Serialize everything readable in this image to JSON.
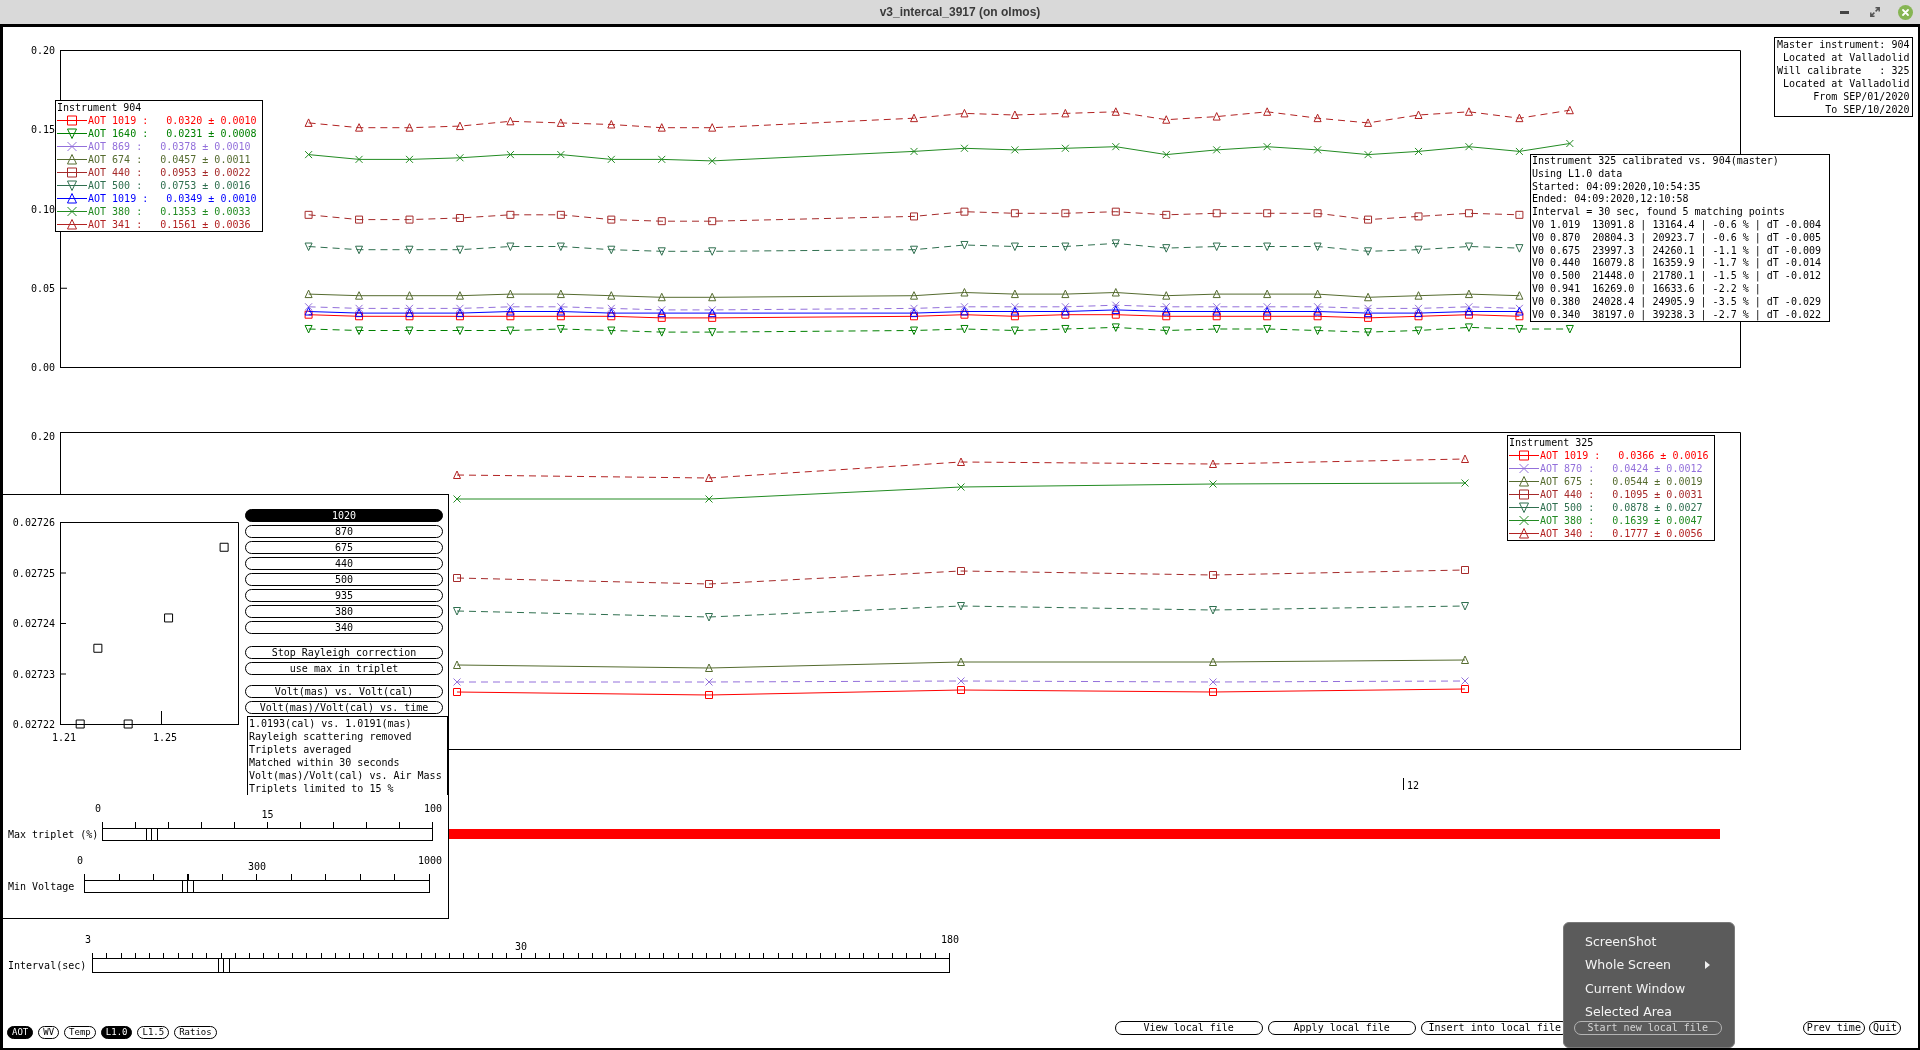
{
  "window": {
    "title": "v3_intercal_3917 (on olmos)"
  },
  "master_info": {
    "lines": [
      "Master instrument: 904",
      "Located at Valladolid",
      "Will calibrate   : 325",
      "Located at Valladolid",
      "From SEP/01/2020",
      "To SEP/10/2020"
    ]
  },
  "top_panel": {
    "legend": {
      "title": "Instrument 904",
      "items": [
        {
          "label": "AOT 1019 :",
          "value": "0.0320 ± 0.0010",
          "color": "#ff0000"
        },
        {
          "label": "AOT 1640 :",
          "value": "0.0231 ± 0.0008",
          "color": "#008000"
        },
        {
          "label": "AOT 869 :",
          "value": "0.0378 ± 0.0010",
          "color": "#9370db"
        },
        {
          "label": "AOT 674 :",
          "value": "0.0457 ± 0.0011",
          "color": "#556b2f"
        },
        {
          "label": "AOT 440 :",
          "value": "0.0953 ± 0.0022",
          "color": "#a52a2a"
        },
        {
          "label": "AOT 500 :",
          "value": "0.0753 ± 0.0016",
          "color": "#2f6f4f"
        },
        {
          "label": "AOT 1019 :",
          "value": "0.0349 ± 0.0010",
          "color": "#0000ff"
        },
        {
          "label": "AOT 380 :",
          "value": "0.1353 ± 0.0033",
          "color": "#228b22"
        },
        {
          "label": "AOT 341 :",
          "value": "0.1561 ± 0.0036",
          "color": "#b22222"
        }
      ]
    },
    "chart_data": {
      "type": "line",
      "categories": [
        null,
        null,
        null,
        null,
        null,
        null,
        null,
        null,
        null,
        null,
        null,
        null,
        null,
        null,
        null,
        null,
        null,
        null,
        null,
        null,
        null,
        null,
        null,
        null,
        null,
        null
      ],
      "ylim": [
        0,
        0.2
      ],
      "yticks": [
        {
          "value": 0,
          "label": "0.00"
        },
        {
          "value": 0.05,
          "label": "0.05"
        },
        {
          "value": 0.1,
          "label": "0.10"
        },
        {
          "value": 0.15,
          "label": "0.15"
        },
        {
          "value": 0.2,
          "label": "0.20"
        }
      ],
      "series": [
        {
          "color": "#ff0000",
          "marker": "square",
          "line_style": "solid",
          "values": [
            0.033,
            0.032,
            0.032,
            0.032,
            0.032,
            0.032,
            0.032,
            0.031,
            0.031,
            null,
            null,
            null,
            0.032,
            0.033,
            0.032,
            0.033,
            0.033,
            0.032,
            0.032,
            0.032,
            0.032,
            0.031,
            0.032,
            0.033,
            0.032,
            null
          ]
        },
        {
          "color": "#008000",
          "marker": "triangle-down",
          "line_style": "dashed",
          "values": [
            0.024,
            0.023,
            0.023,
            0.023,
            0.023,
            0.024,
            0.023,
            0.022,
            0.022,
            null,
            null,
            null,
            0.023,
            0.024,
            0.023,
            0.024,
            0.025,
            0.023,
            0.024,
            0.024,
            0.023,
            0.022,
            0.023,
            0.025,
            0.024,
            0.024
          ]
        },
        {
          "color": "#9370db",
          "marker": "cross",
          "line_style": "dashed",
          "values": [
            0.038,
            0.037,
            0.037,
            0.037,
            0.038,
            0.038,
            0.037,
            0.036,
            0.036,
            null,
            null,
            null,
            0.037,
            0.038,
            0.038,
            0.038,
            0.039,
            0.038,
            0.038,
            0.038,
            0.038,
            0.037,
            0.037,
            0.038,
            0.037,
            null
          ]
        },
        {
          "color": "#556b2f",
          "marker": "triangle-up",
          "line_style": "solid",
          "values": [
            0.046,
            0.045,
            0.045,
            0.045,
            0.046,
            0.046,
            0.045,
            0.044,
            0.044,
            null,
            null,
            null,
            0.045,
            0.047,
            0.046,
            0.046,
            0.047,
            0.045,
            0.046,
            0.046,
            0.046,
            0.044,
            0.045,
            0.046,
            0.045,
            null
          ]
        },
        {
          "color": "#a52a2a",
          "marker": "square",
          "line_style": "dashed",
          "values": [
            0.096,
            0.093,
            0.093,
            0.094,
            0.096,
            0.096,
            0.093,
            0.092,
            0.092,
            null,
            null,
            null,
            0.095,
            0.098,
            0.097,
            0.097,
            0.098,
            0.096,
            0.097,
            0.097,
            0.097,
            0.093,
            0.095,
            0.097,
            0.096,
            null
          ]
        },
        {
          "color": "#2f6f4f",
          "marker": "triangle-down",
          "line_style": "dashed",
          "values": [
            0.076,
            0.074,
            0.074,
            0.074,
            0.076,
            0.076,
            0.074,
            0.073,
            0.073,
            null,
            null,
            null,
            0.074,
            0.077,
            0.076,
            0.076,
            0.078,
            0.075,
            0.076,
            0.076,
            0.076,
            0.073,
            0.074,
            0.076,
            0.075,
            null
          ]
        },
        {
          "color": "#0000ff",
          "marker": "triangle-up",
          "line_style": "solid",
          "values": [
            0.035,
            0.034,
            0.034,
            0.034,
            0.035,
            0.035,
            0.034,
            0.034,
            0.034,
            null,
            null,
            null,
            0.034,
            0.035,
            0.035,
            0.035,
            0.036,
            0.035,
            0.035,
            0.035,
            0.035,
            0.034,
            0.034,
            0.035,
            0.035,
            null
          ]
        },
        {
          "color": "#228b22",
          "marker": "cross",
          "line_style": "solid",
          "values": [
            0.134,
            0.131,
            0.131,
            0.132,
            0.134,
            0.134,
            0.131,
            0.131,
            0.13,
            null,
            null,
            null,
            0.136,
            0.138,
            0.137,
            0.138,
            0.139,
            0.134,
            0.137,
            0.139,
            0.137,
            0.134,
            0.136,
            0.139,
            0.136,
            0.141
          ]
        },
        {
          "color": "#b22222",
          "marker": "triangle-up",
          "line_style": "dashed",
          "values": [
            0.154,
            0.151,
            0.151,
            0.152,
            0.155,
            0.154,
            0.153,
            0.151,
            0.151,
            null,
            null,
            null,
            0.157,
            0.16,
            0.159,
            0.16,
            0.161,
            0.156,
            0.158,
            0.161,
            0.157,
            0.154,
            0.159,
            0.161,
            0.157,
            0.162
          ]
        }
      ]
    }
  },
  "calibration_report": {
    "lines": [
      "Instrument 325 calibrated vs. 904(master)",
      "Using L1.0 data",
      "Started: 04:09:2020,10:54:35",
      "Ended: 04:09:2020,12:10:58",
      "Interval = 30 sec, found 5 matching points",
      "V0 1.019  13091.8 | 13164.4 | -0.6 % | dT -0.004",
      "V0 0.870  20804.3 | 20923.7 | -0.6 % | dT -0.005",
      "V0 0.675  23997.3 | 24260.1 | -1.1 % | dT -0.009",
      "V0 0.440  16079.8 | 16359.9 | -1.7 % | dT -0.014",
      "V0 0.500  21448.0 | 21780.1 | -1.5 % | dT -0.012",
      "V0 0.941  16269.0 | 16633.6 | -2.2 % |",
      "V0 0.380  24028.4 | 24905.9 | -3.5 % | dT -0.029",
      "V0 0.340  38197.0 | 39238.3 | -2.7 % | dT -0.022"
    ]
  },
  "bottom_panel": {
    "y_tick_label": "0.20",
    "x_tick_label": "12",
    "legend": {
      "title": "Instrument 325",
      "items": [
        {
          "label": "AOT 1019 :",
          "value": "0.0366 ± 0.0016",
          "color": "#ff0000",
          "kind": "square"
        },
        {
          "label": "AOT 870 :",
          "value": "0.0424 ± 0.0012",
          "color": "#9370db",
          "kind": "cross"
        },
        {
          "label": "AOT 675 :",
          "value": "0.0544 ± 0.0019",
          "color": "#556b2f",
          "kind": "triangle-up"
        },
        {
          "label": "AOT 440 :",
          "value": "0.1095 ± 0.0031",
          "color": "#a52a2a",
          "kind": "square"
        },
        {
          "label": "AOT 500 :",
          "value": "0.0878 ± 0.0027",
          "color": "#2f6f4f",
          "kind": "triangle-down"
        },
        {
          "label": "AOT 380 :",
          "value": "0.1639 ± 0.0047",
          "color": "#228b22",
          "kind": "cross"
        },
        {
          "label": "AOT 340 :",
          "value": "0.1777 ± 0.0056",
          "color": "#b22222",
          "kind": "triangle-up"
        }
      ]
    }
  },
  "calibration_panel": {
    "chart_data": {
      "type": "scatter",
      "x": [
        1.218,
        1.225,
        1.237,
        1.253,
        1.275
      ],
      "values": [
        0.02722,
        0.027235,
        0.02722,
        0.027241,
        0.027255
      ],
      "xlim": [
        1.21,
        1.2805
      ],
      "ylim": [
        0.02722,
        0.02726
      ],
      "xticks": [
        1.21,
        1.25
      ],
      "yticks": [
        0.02722,
        0.02723,
        0.02724,
        0.02725,
        0.02726
      ]
    },
    "wavelength_buttons": [
      {
        "label": "1020",
        "selected": true
      },
      {
        "label": "870",
        "selected": false
      },
      {
        "label": "675",
        "selected": false
      },
      {
        "label": "440",
        "selected": false
      },
      {
        "label": "500",
        "selected": false
      },
      {
        "label": "935",
        "selected": false
      },
      {
        "label": "380",
        "selected": false
      },
      {
        "label": "340",
        "selected": false
      }
    ],
    "option_buttons": [
      "Stop Rayleigh correction",
      "use max in triplet"
    ],
    "plot_buttons": [
      "Volt(mas) vs. Volt(cal)",
      "Volt(mas)/Volt(cal) vs. time"
    ],
    "notes": [
      "1.0193(cal) vs. 1.0191(mas)",
      "Rayleigh scattering removed",
      "Triplets averaged",
      "Matched within 30 seconds",
      "Volt(mas)/Volt(cal) vs. Air Mass",
      "Triplets limited to 15 %"
    ],
    "sliders": [
      {
        "label": "Max triplet (%)",
        "min_label": "0",
        "value": "15",
        "max_label": "100",
        "level": 0.15
      },
      {
        "label": "Min Voltage",
        "min_label": "0",
        "value": "300",
        "max_label": "1000",
        "level": 0.3
      }
    ]
  },
  "interval_slider": {
    "label": "Interval(sec)",
    "min_label": "3",
    "value": "30",
    "max_label": "180",
    "level": 0.153
  },
  "mode_toggles": [
    {
      "label": "AOT",
      "selected": true
    },
    {
      "label": "WV",
      "selected": false
    },
    {
      "label": "Temp",
      "selected": false
    },
    {
      "label": "L1.0",
      "selected": true
    },
    {
      "label": "L1.5",
      "selected": false
    },
    {
      "label": "Ratios",
      "selected": false
    }
  ],
  "file_buttons": [
    "View local file",
    "Apply local file",
    "Insert into local file",
    "Start new local file"
  ],
  "nav_buttons": [
    "Prev time",
    "Quit"
  ],
  "context_menu": {
    "items": [
      {
        "label": "ScreenShot",
        "submenu": false
      },
      {
        "label": "Whole Screen",
        "submenu": true
      },
      {
        "label": "Current Window",
        "submenu": false
      },
      {
        "label": "Selected Area",
        "submenu": false
      }
    ]
  }
}
